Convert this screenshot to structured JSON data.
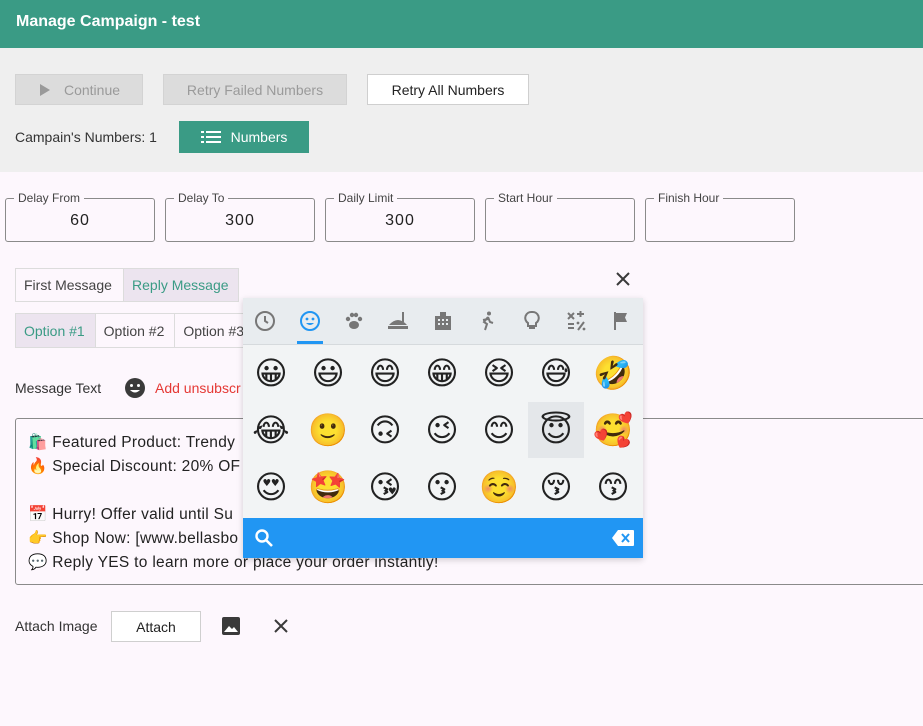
{
  "title": "Manage Campaign - test",
  "actions": {
    "continue": "Continue",
    "retry_failed": "Retry Failed Numbers",
    "retry_all": "Retry All Numbers",
    "numbers_count_label": "Campain's Numbers: 1",
    "numbers_button": "Numbers"
  },
  "fields": [
    {
      "label": "Delay From",
      "value": "60"
    },
    {
      "label": "Delay To",
      "value": "300"
    },
    {
      "label": "Daily Limit",
      "value": "300"
    },
    {
      "label": "Start Hour",
      "value": ""
    },
    {
      "label": "Finish Hour",
      "value": ""
    }
  ],
  "message_tabs": [
    {
      "label": "First Message",
      "active": false
    },
    {
      "label": "Reply Message",
      "active": true
    }
  ],
  "option_tabs": [
    {
      "label": "Option #1",
      "active": true
    },
    {
      "label": "Option #2",
      "active": false
    },
    {
      "label": "Option #3",
      "active": false
    }
  ],
  "message_text_label": "Message Text",
  "add_unsubscribe": "Add unsubscr",
  "message_lines": [
    "🛍️ Featured Product: Trendy",
    "🔥 Special Discount: 20% OF",
    "",
    "📅 Hurry! Offer valid until Su",
    "👉 Shop Now: [www.bellasbo",
    "💬 Reply YES to learn more or place your order instantly!"
  ],
  "attach_image_label": "Attach Image",
  "attach_button": "Attach",
  "emoji_picker": {
    "categories": [
      "clock-icon",
      "smiley-icon",
      "paw-icon",
      "food-icon",
      "building-icon",
      "runner-icon",
      "bulb-icon",
      "symbols-icon",
      "flag-icon"
    ],
    "active_category": "smiley-icon",
    "emojis": [
      "😀",
      "😃",
      "😄",
      "😁",
      "😆",
      "😅",
      "🤣",
      "😂",
      "🙂",
      "🙃",
      "😉",
      "😊",
      "😇",
      "🥰",
      "😍",
      "🤩",
      "😘",
      "😗",
      "☺️",
      "😚",
      "😙"
    ],
    "selected_index": 12,
    "colors": {
      "accent": "#2196f3",
      "tab_bar": "#e8ecef"
    }
  },
  "colors": {
    "brand": "#3a9b85",
    "danger": "#e53935"
  }
}
